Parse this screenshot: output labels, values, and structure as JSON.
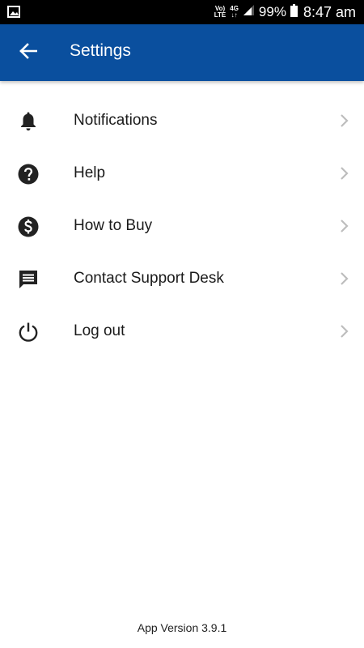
{
  "status_bar": {
    "volte_top": "Vo)",
    "volte_bottom": "LTE",
    "network_top": "4G",
    "network_bottom": "↓↑",
    "battery": "99%",
    "time": "8:47 am"
  },
  "app_bar": {
    "title": "Settings",
    "color": "#0a4f9e"
  },
  "settings_items": [
    {
      "label": "Notifications",
      "icon": "bell-icon"
    },
    {
      "label": "Help",
      "icon": "help-circle-icon"
    },
    {
      "label": "How to Buy",
      "icon": "dollar-circle-icon"
    },
    {
      "label": "Contact Support Desk",
      "icon": "chat-icon"
    },
    {
      "label": "Log out",
      "icon": "power-icon"
    }
  ],
  "footer": {
    "app_version": "App Version 3.9.1"
  }
}
